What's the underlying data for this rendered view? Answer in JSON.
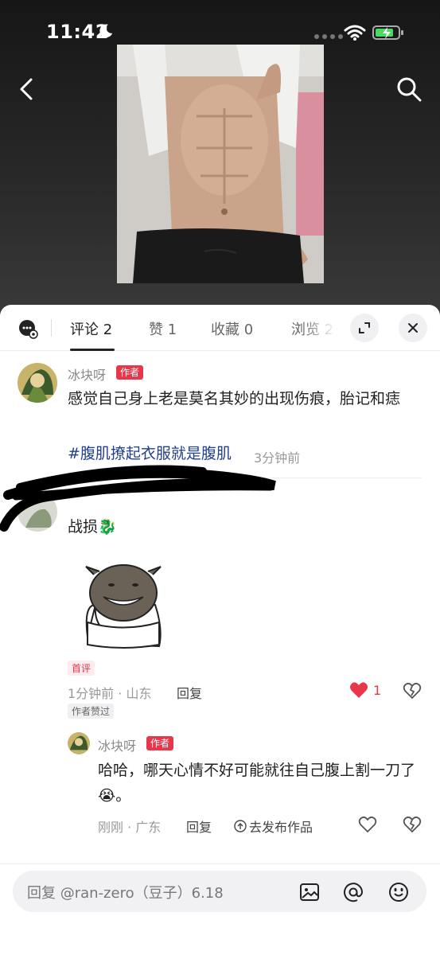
{
  "status": {
    "time": "11:42"
  },
  "tabs": [
    {
      "label": "评论 2",
      "active": true
    },
    {
      "label": "赞 1",
      "active": false
    },
    {
      "label": "收藏 0",
      "active": false
    },
    {
      "label": "浏览 2",
      "active": false
    }
  ],
  "post": {
    "author": "冰块呀",
    "author_badge": "作者",
    "text": "感觉自己身上老是莫名其妙的出现伤痕，胎记和痣",
    "hashtag": "#腹肌撩起衣服就是腹肌",
    "time": "3分钟前"
  },
  "comment": {
    "text": "战损🐉",
    "first_tag": "首评",
    "meta": "1分钟前 · 山东",
    "reply_label": "回复",
    "likes": "1",
    "author_liked_tag": "作者赞过"
  },
  "reply": {
    "author": "冰块呀",
    "author_badge": "作者",
    "text": "哈哈，哪天心情不好可能就往自己腹上割一刀了😭。",
    "meta": "刚刚 · 广东",
    "reply_label": "回复",
    "publish_label": "去发布作品"
  },
  "input": {
    "placeholder": "回复 @ran-zero（豆子）6.18"
  },
  "colors": {
    "accent": "#e8374a",
    "hashtag": "#1f3f8f"
  },
  "icons": [
    "back-icon",
    "search-icon",
    "chat-icon",
    "expand-icon",
    "close-icon",
    "heart-icon",
    "broken-heart-icon",
    "image-icon",
    "at-icon",
    "emoji-icon"
  ]
}
